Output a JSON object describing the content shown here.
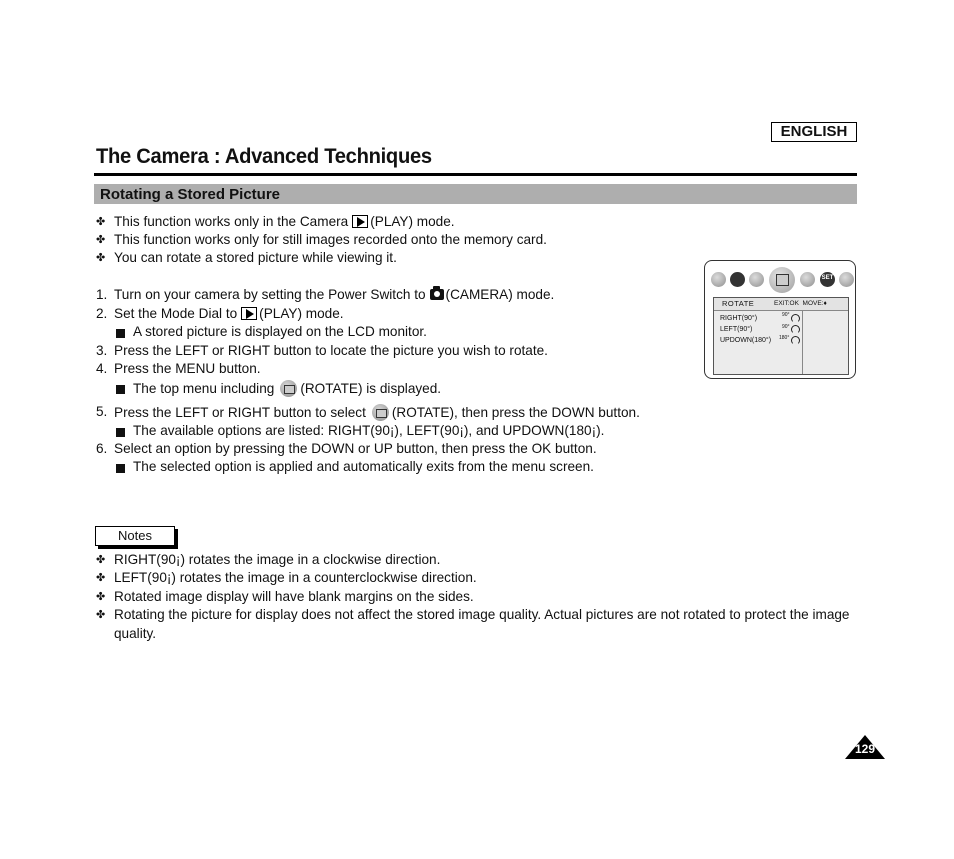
{
  "header": {
    "language": "ENGLISH",
    "title": "The Camera : Advanced Techniques",
    "section_title": "Rotating a Stored Picture"
  },
  "intro_bullets": [
    {
      "before": "This function works only in the Camera",
      "icon": "play-mode-icon",
      "after": "(PLAY) mode."
    },
    {
      "text": "This function works only for still images recorded onto the memory card."
    },
    {
      "text": "You can rotate a stored picture while viewing it."
    }
  ],
  "steps": [
    {
      "num": "1.",
      "before": "Turn on your camera by setting the Power Switch to",
      "icon": "camera-mode-icon",
      "after": "(CAMERA) mode."
    },
    {
      "num": "2.",
      "before": "Set the Mode Dial to",
      "icon": "play-mode-icon",
      "after": "(PLAY) mode.",
      "sub": "A stored picture is displayed on the LCD monitor."
    },
    {
      "num": "3.",
      "text": "Press the LEFT or RIGHT button to locate the picture you wish to rotate."
    },
    {
      "num": "4.",
      "text": "Press the MENU button.",
      "sub_before": "The top menu including",
      "sub_icon": "rotate-icon",
      "sub_after": "(ROTATE) is displayed."
    },
    {
      "num": "5.",
      "before": "Press the LEFT or RIGHT button to select",
      "icon": "rotate-icon",
      "after": "(ROTATE), then press the DOWN button.",
      "sub": "The available options are listed: RIGHT(90¡), LEFT(90¡), and UPDOWN(180¡)."
    },
    {
      "num": "6.",
      "text": "Select an option by pressing the DOWN or UP button, then press the OK button.",
      "sub": "The selected option is applied and automatically exits from the menu screen."
    }
  ],
  "notes": {
    "label": "Notes",
    "items": [
      "RIGHT(90¡) rotates the image in a clockwise direction.",
      "LEFT(90¡) rotates the image in a counterclockwise direction.",
      "Rotated image display will have blank margins on the sides.",
      "Rotating the picture for display does not affect the stored image quality. Actual pictures are not rotated to protect the image",
      "quality."
    ]
  },
  "lcd": {
    "menu_icons": [
      "protect-icon",
      "dpof-icon",
      "slideshow-icon",
      "rotate-icon",
      "print-icon",
      "setup-icon",
      "user-icon"
    ],
    "setup_label": "SET",
    "menu_title": "ROTATE",
    "hint": "EXIT:OK  MOVE:♦",
    "options": [
      {
        "label": "RIGHT(90°)",
        "degree": "90°"
      },
      {
        "label": "LEFT(90°)",
        "degree": "90°"
      },
      {
        "label": "UPDOWN(180°)",
        "degree": "180°"
      }
    ]
  },
  "page_number": "129",
  "bullet_glyph": "✤"
}
